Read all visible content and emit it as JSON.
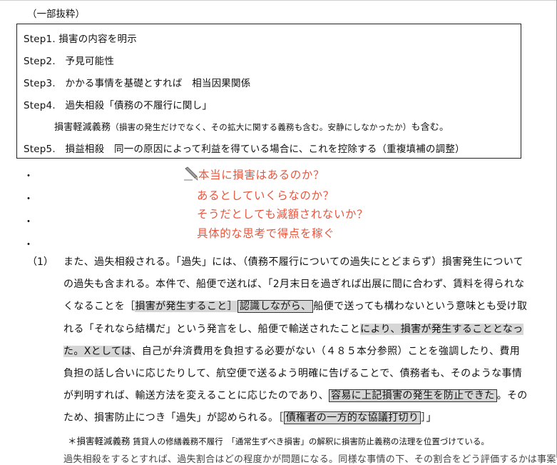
{
  "excerpt_label": "（一部抜粋）",
  "steps": [
    "Step1. 損害の内容を明示",
    "Step2.　予見可能性",
    "Step3.　かかる事情を基礎とすれば　相当因果関係",
    "Step4.　過失相殺「債務の不履行に関し」"
  ],
  "step_sub": {
    "main": "損害軽減義務",
    "paren": "（損害の発生だけでなく、その拡大に関する義務も含む。安静にしなかったか）",
    "tail": "も含む。"
  },
  "step5": "Step5.　損益相殺　同一の原因によって利益を得ている場合に、これを控除する（重複填補の調整）",
  "bullets": [
    "・",
    "・",
    "・",
    "・"
  ],
  "questions": [
    "本当に損害はあるのか？",
    "あるとしていくらなのか？",
    "そうだとしても減額されないか？",
    "具体的な思考で得点を稼ぐ"
  ],
  "para": {
    "number": "（1）",
    "l1": "また、過失相殺される。「過失」には、（債務不履行についての過失にとどまらず）損害発生について",
    "l2": "の過失も含まれる。本件で、船便で送れば、「2月末日を過ぎれば出展に間に合わず、賃料を得られな",
    "l3a": "くなることを［",
    "l3b": "損害が発生すること］",
    "l3c": "認識しながら、",
    "l3d": "船便で送っても構わないという意味とも受け取",
    "l4a": "れる「それなら結構だ」という発言をし、船便で輸送されたこと",
    "l4b": "により、損害が発生することとなっ",
    "l5a": "た。Xとしては",
    "l5b": "、自己が弁済費用を負担する必要がない（４８５本分参照）ことを強調したり、費用",
    "l6": "負担の話し合いに応じたりして、航空便で送るよう明確に告げることで、債務者も、そのような事情",
    "l7a": "が判明すれば、輸送方法を変えることに応じたのであり、",
    "l7b": "容易に上記損害の発生を防止できた",
    "l7c": "。その",
    "l8a": "ため、損害防止につき「過失」が認められる。［",
    "l8b": "債権者の一方的な協議打切り",
    "l8c": "］」"
  },
  "note": {
    "main": "＊損害軽減義務",
    "rest": " 賃貸人の修繕義務不履行　「通常生ずべき損害」の解釈に損害防止義務の法理を位置づけている。"
  },
  "cutoff_line": "過失相殺をするとすれば、過失割合はどの程度かが問題になる。同様な事情の下、その割合をどう評価するかは事案の"
}
